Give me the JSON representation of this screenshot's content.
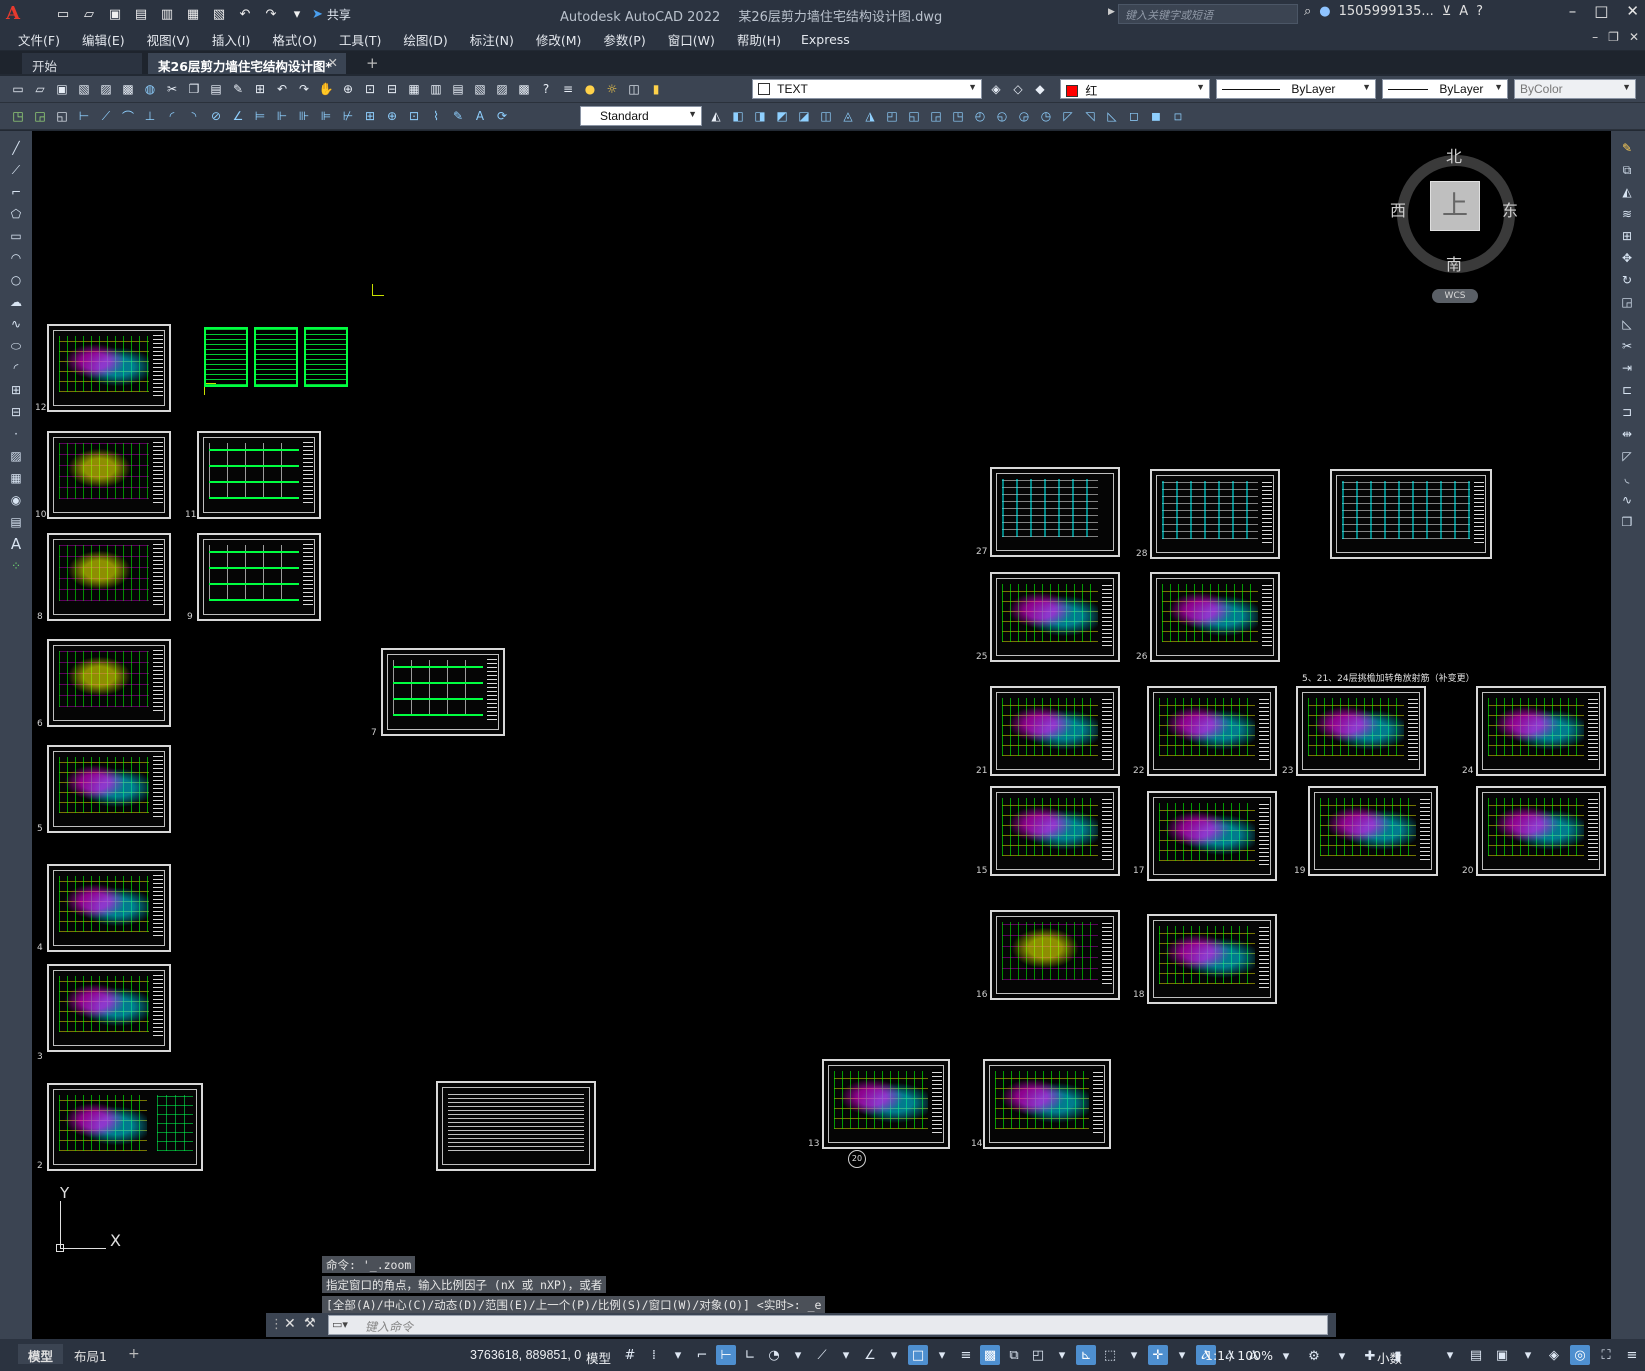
{
  "app": {
    "logo": "A",
    "title": "Autodesk AutoCAD 2022",
    "file": "某26层剪力墙住宅结构设计图.dwg",
    "share": "共享",
    "search_placeholder": "键入关键字或短语",
    "user": "1505999135..."
  },
  "menu": [
    "文件(F)",
    "编辑(E)",
    "视图(V)",
    "插入(I)",
    "格式(O)",
    "工具(T)",
    "绘图(D)",
    "标注(N)",
    "修改(M)",
    "参数(P)",
    "窗口(W)",
    "帮助(H)",
    "Express"
  ],
  "tabs": {
    "start": "开始",
    "drawing": "某26层剪力墙住宅结构设计图*"
  },
  "toolbar": {
    "layer": "TEXT",
    "color": "红",
    "color_hex": "#ff0000",
    "linetype": "ByLayer",
    "lineweight": "ByLayer",
    "plotstyle": "ByColor",
    "textstyle": "Standard"
  },
  "viewcube": {
    "north": "北",
    "south": "南",
    "east": "东",
    "west": "西",
    "top": "上",
    "wcs": "WCS"
  },
  "ucs": {
    "x": "X",
    "y": "Y"
  },
  "sheets": {
    "s2": "2",
    "s3": "3",
    "s4": "4",
    "s5": "5",
    "s6": "6",
    "s7": "7",
    "s8": "8",
    "s9": "9",
    "s10": "10",
    "s11": "11",
    "s12": "12",
    "s13": "13",
    "s14": "14",
    "s15": "15",
    "s16": "16",
    "s17": "17",
    "s18": "18",
    "s19": "19",
    "s20": "20",
    "s21": "21",
    "s22": "22",
    "s23": "23",
    "s24": "24",
    "s25": "25",
    "s26": "26",
    "s27": "27",
    "s28": "28",
    "note": "5、21、24层挑檐加转角放射筋（补变更）",
    "circle_label": "20"
  },
  "command": {
    "history": [
      "命令: '_.zoom",
      "指定窗口的角点，输入比例因子 (nX 或 nXP)，或者",
      "[全部(A)/中心(C)/动态(D)/范围(E)/上一个(P)/比例(S)/窗口(W)/对象(O)] <实时>: _e"
    ],
    "placeholder": "键入命令"
  },
  "status": {
    "model_tab": "模型",
    "layout1_tab": "布局1",
    "coords": "3763618, 889851, 0",
    "model": "模型",
    "scale": "1:1 / 100%",
    "units": "小数"
  }
}
